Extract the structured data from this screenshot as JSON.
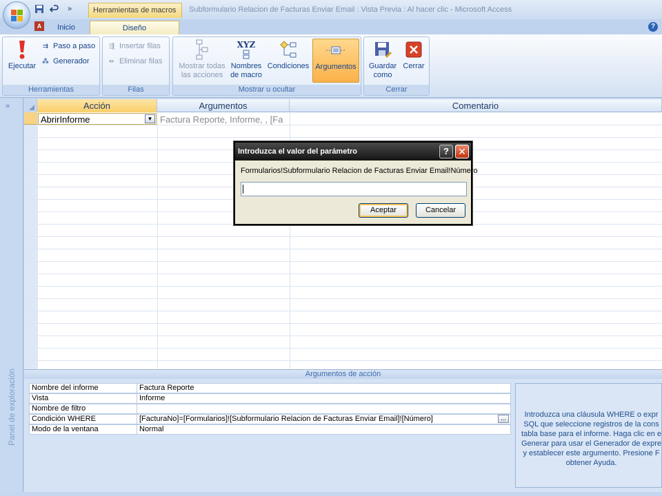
{
  "window": {
    "title": "Subformulario Relacion de Facturas Enviar Email : Vista Previa : Al hacer clic - Microsoft Access",
    "context_tab": "Herramientas de macros"
  },
  "tabs": {
    "inicio": "Inicio",
    "diseno": "Diseño"
  },
  "ribbon": {
    "herramientas": {
      "label": "Herramientas",
      "ejecutar": "Ejecutar",
      "paso_a_paso": "Paso a paso",
      "generador": "Generador"
    },
    "filas": {
      "label": "Filas",
      "insertar": "Insertar filas",
      "eliminar": "Eliminar filas"
    },
    "mostrar": {
      "label": "Mostrar u ocultar",
      "mostrar_todas_1": "Mostrar todas",
      "mostrar_todas_2": "las acciones",
      "nombres_1": "Nombres",
      "nombres_2": "de macro",
      "condiciones": "Condiciones",
      "argumentos": "Argumentos",
      "xyz": "XYZ"
    },
    "cerrar": {
      "label": "Cerrar",
      "guardar_1": "Guardar",
      "guardar_2": "como",
      "cerrar": "Cerrar"
    }
  },
  "nav_pane": {
    "label": "Panel de exploración",
    "toggle": "»"
  },
  "grid": {
    "headers": {
      "accion": "Acción",
      "argumentos": "Argumentos",
      "comentario": "Comentario"
    },
    "rows": [
      {
        "accion": "AbrirInforme",
        "argumentos": "Factura Reporte, Informe, , [Fa"
      }
    ]
  },
  "action_args": {
    "header": "Argumentos de acción",
    "rows": [
      {
        "label": "Nombre del informe",
        "value": "Factura Reporte"
      },
      {
        "label": "Vista",
        "value": "Informe"
      },
      {
        "label": "Nombre de filtro",
        "value": ""
      },
      {
        "label": "Condición WHERE",
        "value": "[FacturaNo]=[Formularios]![Subformulario Relacion de Facturas Enviar Email]![Número]"
      },
      {
        "label": "Modo de la ventana",
        "value": "Normal"
      }
    ],
    "builder_button": "...",
    "help_lines": [
      "Introduzca una cláusula WHERE o expr",
      "SQL que seleccione registros de la cons",
      "tabla base para el informe. Haga clic en e",
      "Generar para usar el Generador de expre",
      "y establecer este argumento. Presione F",
      "obtener Ayuda."
    ]
  },
  "dialog": {
    "title": "Introduzca el valor del parámetro",
    "prompt": "Formularios!Subformulario Relacion de Facturas Enviar Email!Número",
    "input_value": "",
    "ok": "Aceptar",
    "cancel": "Cancelar",
    "help_glyph": "?",
    "close_glyph": "✕"
  },
  "colors": {
    "ribbon_active": "#fbb14a",
    "dialog_title": "#141414",
    "close_red": "#c1330e",
    "ejecutar_red": "#e0322a"
  }
}
